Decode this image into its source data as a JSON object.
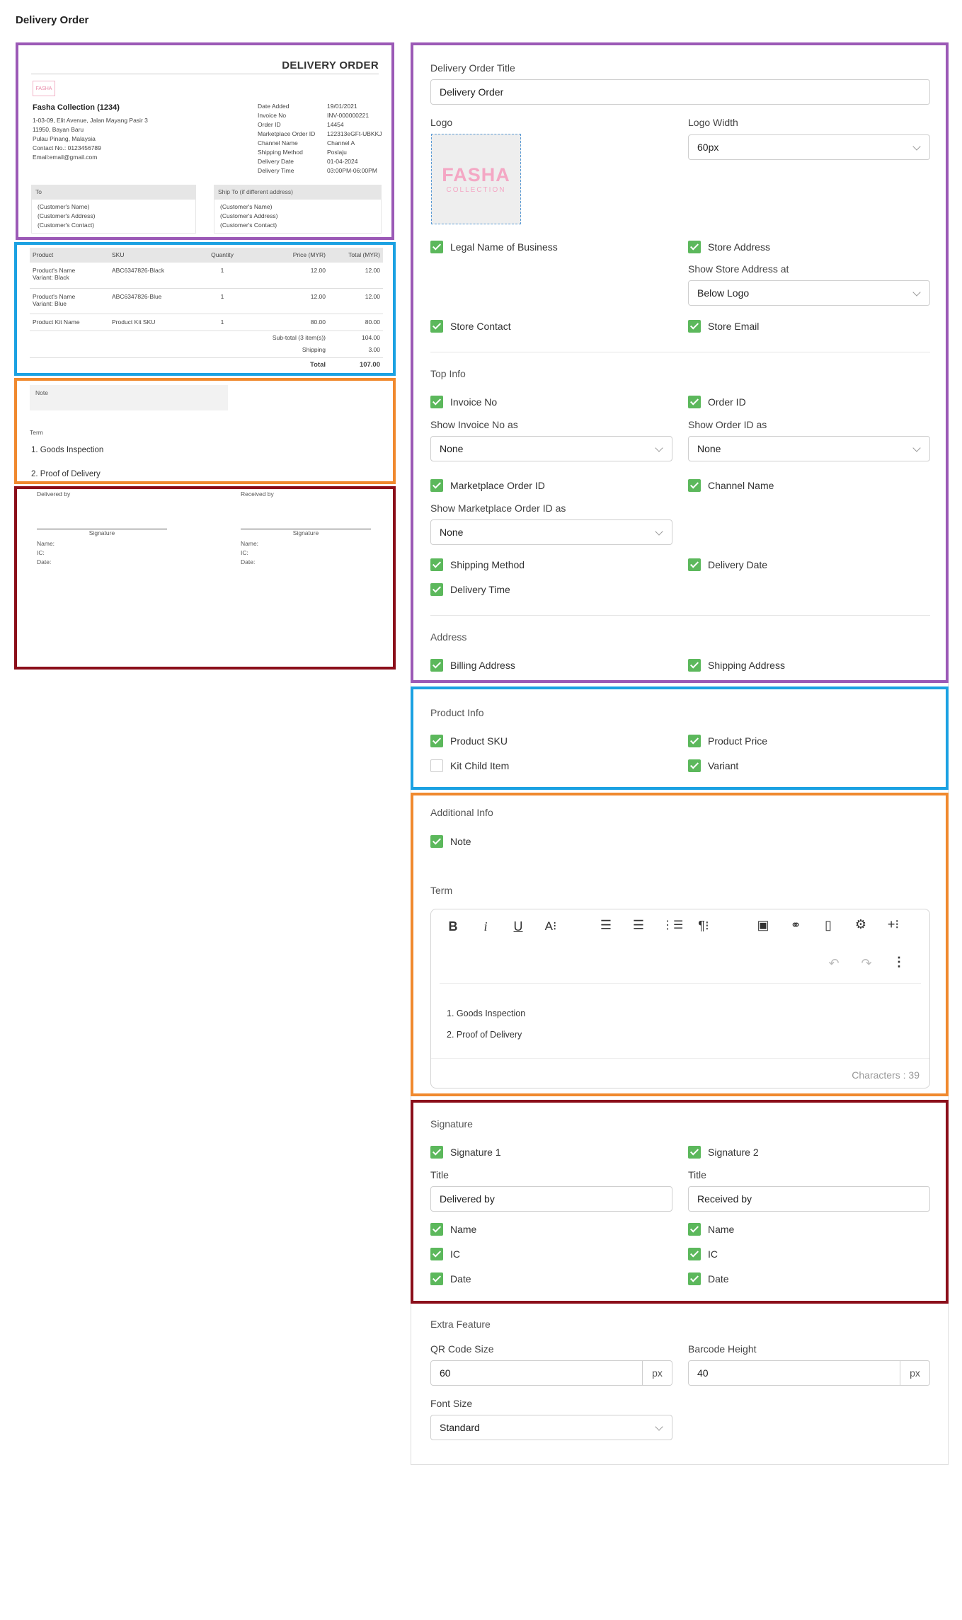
{
  "page": {
    "title": "Delivery Order"
  },
  "colors": {
    "purple": "#9b59b6",
    "blue": "#1ba1e2",
    "orange": "#f0892e",
    "darkred": "#8b0e1a",
    "check": "#5cb85c"
  },
  "preview": {
    "doc_title": "DELIVERY ORDER",
    "logo_text": "FASHA",
    "business_name": "Fasha Collection (1234)",
    "address_lines": [
      "1-03-09, Elit Avenue, Jalan Mayang Pasir 3",
      "11950, Bayan Baru",
      "Pulau Pinang, Malaysia",
      "Contact No.: 0123456789",
      "Email:email@gmail.com"
    ],
    "info": [
      {
        "k": "Date Added",
        "v": "19/01/2021"
      },
      {
        "k": "Invoice No",
        "v": "INV-000000221"
      },
      {
        "k": "Order ID",
        "v": "14454"
      },
      {
        "k": "Marketplace Order ID",
        "v": "122313eGFt-UBKKJ"
      },
      {
        "k": "Channel Name",
        "v": "Channel A"
      },
      {
        "k": "Shipping Method",
        "v": "Poslaju"
      },
      {
        "k": "Delivery Date",
        "v": "01-04-2024"
      },
      {
        "k": "Delivery Time",
        "v": "03:00PM-06:00PM"
      }
    ],
    "to": {
      "label": "To",
      "lines": [
        "(Customer's Name)",
        "(Customer's Address)",
        "(Customer's Contact)"
      ]
    },
    "ship_to": {
      "label": "Ship To (if different address)",
      "lines": [
        "(Customer's Name)",
        "(Customer's Address)",
        "(Customer's Contact)"
      ]
    },
    "table": {
      "headers": [
        "Product",
        "SKU",
        "Quantity",
        "Price (MYR)",
        "Total (MYR)"
      ],
      "rows": [
        {
          "product": "Product's Name",
          "variant": "Variant: Black",
          "sku": "ABC6347826-Black",
          "qty": "1",
          "price": "12.00",
          "total": "12.00"
        },
        {
          "product": "Product's Name",
          "variant": "Variant: Blue",
          "sku": "ABC6347826-Blue",
          "qty": "1",
          "price": "12.00",
          "total": "12.00"
        },
        {
          "product": "Product Kit Name",
          "variant": "",
          "sku": "Product Kit SKU",
          "qty": "1",
          "price": "80.00",
          "total": "80.00"
        }
      ],
      "subtotal_label": "Sub-total (3 item(s))",
      "subtotal": "104.00",
      "shipping_label": "Shipping",
      "shipping": "3.00",
      "total_label": "Total",
      "total": "107.00"
    },
    "note_label": "Note",
    "term_label": "Term",
    "terms": [
      "1. Goods Inspection",
      "2. Proof of Delivery"
    ],
    "sig": [
      {
        "title": "Delivered by",
        "sign": "Signature",
        "name": "Name:",
        "ic": "IC:",
        "date": "Date:"
      },
      {
        "title": "Received by",
        "sign": "Signature",
        "name": "Name:",
        "ic": "IC:",
        "date": "Date:"
      }
    ]
  },
  "form": {
    "do_title_label": "Delivery Order Title",
    "do_title_value": "Delivery Order",
    "logo_label": "Logo",
    "logo_text1": "FASHA",
    "logo_text2": "COLLECTION",
    "logo_width_label": "Logo Width",
    "logo_width_value": "60px",
    "legal_name": "Legal Name of Business",
    "store_address": "Store Address",
    "show_store_addr_label": "Show Store Address at",
    "show_store_addr_value": "Below Logo",
    "store_contact": "Store Contact",
    "store_email": "Store Email",
    "top_info": "Top Info",
    "invoice_no": "Invoice No",
    "order_id": "Order ID",
    "show_invoice_label": "Show Invoice No as",
    "show_invoice_value": "None",
    "show_order_label": "Show Order ID as",
    "show_order_value": "None",
    "mp_order_id": "Marketplace Order ID",
    "channel_name": "Channel Name",
    "show_mp_label": "Show Marketplace Order ID as",
    "show_mp_value": "None",
    "shipping_method": "Shipping Method",
    "delivery_date": "Delivery Date",
    "delivery_time": "Delivery Time",
    "address": "Address",
    "billing": "Billing Address",
    "shipping_addr": "Shipping Address",
    "product_info": "Product Info",
    "product_sku": "Product SKU",
    "product_price": "Product Price",
    "kit_child": "Kit Child Item",
    "variant": "Variant",
    "additional_info": "Additional Info",
    "note": "Note",
    "term": "Term",
    "term_lines": [
      "1. Goods Inspection",
      "2. Proof of Delivery"
    ],
    "characters": "Characters : 39",
    "signature": "Signature",
    "sig1": "Signature 1",
    "sig2": "Signature 2",
    "title_label": "Title",
    "sig1_title": "Delivered by",
    "sig2_title": "Received by",
    "name": "Name",
    "ic": "IC",
    "date": "Date",
    "extra_feature": "Extra Feature",
    "qr_label": "QR Code Size",
    "qr_value": "60",
    "barcode_label": "Barcode Height",
    "barcode_value": "40",
    "px": "px",
    "font_size_label": "Font Size",
    "font_size_value": "Standard"
  }
}
